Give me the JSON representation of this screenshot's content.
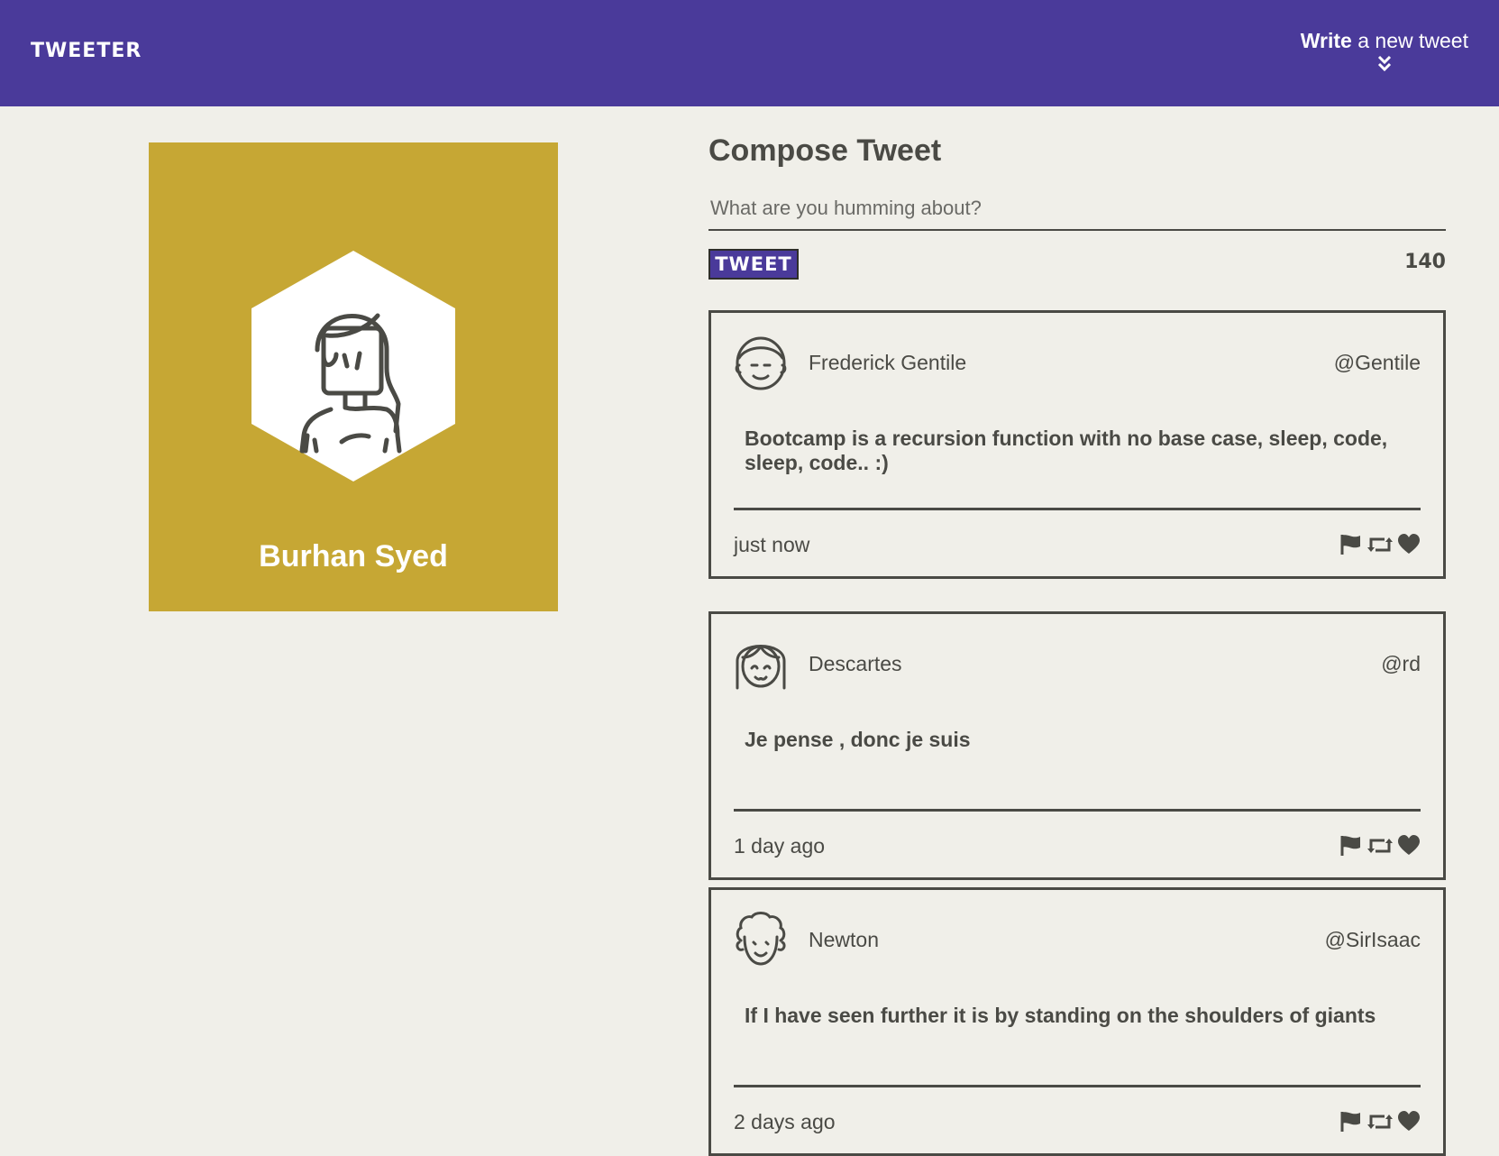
{
  "nav": {
    "brand": "TWEETER",
    "compose_bold": "Write",
    "compose_rest": " a new tweet"
  },
  "profile": {
    "name": "Burhan Syed",
    "avatar_icon": "woman-avatar-icon",
    "background_color": "#c6a734"
  },
  "compose": {
    "title": "Compose Tweet",
    "placeholder": "What are you humming about?",
    "button_label": "TWEET",
    "counter": "140"
  },
  "tweets": [
    {
      "name": "Frederick Gentile",
      "handle": "@Gentile",
      "content": "Bootcamp is a recursion function with no base case, sleep, code, sleep, code.. :)",
      "time": "just now",
      "avatar_icon": "man-avatar-icon"
    },
    {
      "name": "Descartes",
      "handle": "@rd",
      "content": "Je pense , donc je suis",
      "time": "1 day ago",
      "avatar_icon": "bangs-avatar-icon"
    },
    {
      "name": "Newton",
      "handle": "@SirIsaac",
      "content": "If I have seen further it is by standing on the shoulders of giants",
      "time": "2 days ago",
      "avatar_icon": "curly-hair-avatar-icon"
    }
  ],
  "colors": {
    "accent": "#4a3a9a",
    "background": "#f0efe9",
    "text": "#4a4a45"
  }
}
